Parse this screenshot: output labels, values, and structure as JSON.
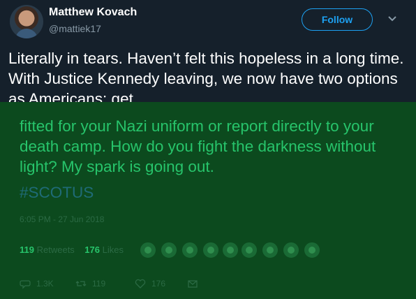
{
  "author": {
    "name": "Matthew Kovach",
    "handle": "@mattiek17",
    "follow_label": "Follow"
  },
  "tweet": {
    "text_main": "Literally in tears. Haven’t felt this hopeless in a long time. With Justice Kennedy leaving, we now have two options as Americans: get",
    "text_overlay": "fitted for your Nazi uniform or report directly to your death camp. How do you fight the darkness without light? My spark is going out.",
    "hashtag": "#SCOTUS",
    "timestamp": "6:05 PM - 27 Jun 2018"
  },
  "stats": {
    "retweets_count": "119",
    "retweets_label": "Retweets",
    "likes_count": "176",
    "likes_label": "Likes"
  },
  "actions": {
    "reply_count": "1.3K",
    "retweet_count": "119",
    "like_count": "176"
  },
  "colors": {
    "background": "#15202b",
    "overlay_green": "#0c4a1e",
    "accent": "#1da1f2",
    "overlay_text": "#27c46b"
  },
  "icons": [
    "chevron-down-icon",
    "reply-icon",
    "retweet-icon",
    "like-icon",
    "mail-icon"
  ]
}
